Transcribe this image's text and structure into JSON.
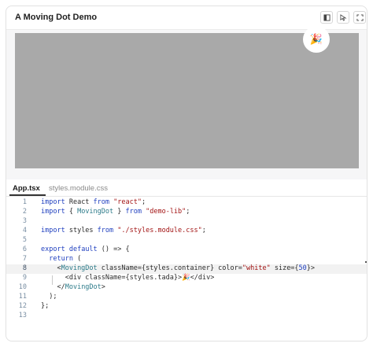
{
  "window": {
    "title": "A Moving Dot Demo"
  },
  "toolbar": {
    "buttons": [
      {
        "icon": "panel-icon"
      },
      {
        "icon": "cursor-icon"
      },
      {
        "icon": "expand-icon"
      }
    ]
  },
  "preview": {
    "canvas_color": "#a9a9a9",
    "dot_emoji": "🎉"
  },
  "tabs": [
    {
      "label": "App.tsx",
      "active": true
    },
    {
      "label": "styles.module.css",
      "active": false
    }
  ],
  "code": {
    "active_line": 8,
    "lines": [
      {
        "n": "1",
        "text": "import React from \"react\";"
      },
      {
        "n": "2",
        "text": "import { MovingDot } from \"demo-lib\";"
      },
      {
        "n": "3",
        "text": ""
      },
      {
        "n": "4",
        "text": "import styles from \"./styles.module.css\";"
      },
      {
        "n": "5",
        "text": ""
      },
      {
        "n": "6",
        "text": "export default () => {"
      },
      {
        "n": "7",
        "text": "  return ("
      },
      {
        "n": "8",
        "text": "    <MovingDot className={styles.container} color=\"white\" size={50}>"
      },
      {
        "n": "9",
        "text": "      <div className={styles.tada}>🎉</div>"
      },
      {
        "n": "10",
        "text": "    </MovingDot>"
      },
      {
        "n": "11",
        "text": "  );"
      },
      {
        "n": "12",
        "text": "};"
      },
      {
        "n": "13",
        "text": ""
      }
    ]
  }
}
